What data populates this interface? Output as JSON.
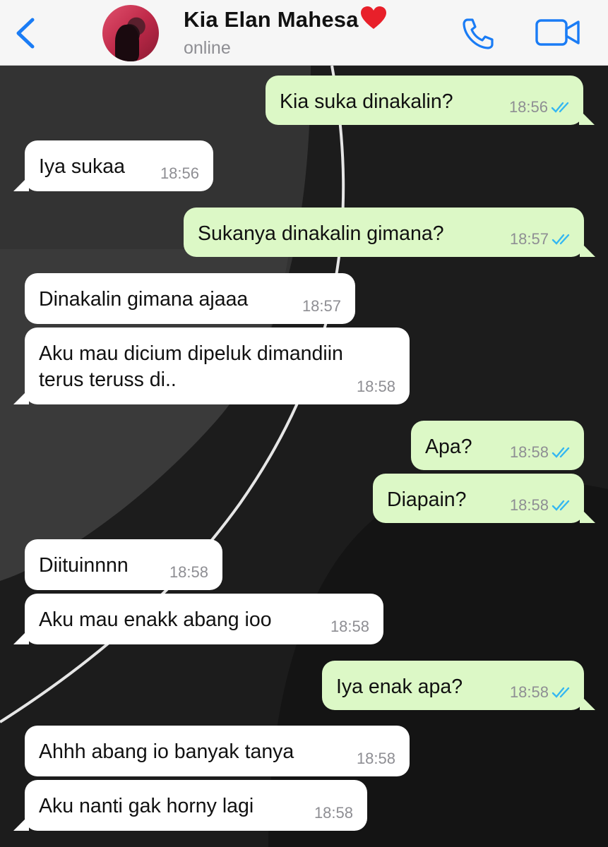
{
  "header": {
    "contact_name": "Kia Elan Mahesa",
    "status": "online",
    "accent_color": "#1a7cf5"
  },
  "messages": [
    {
      "dir": "out",
      "text": "Kia suka dinakalin?",
      "time": "18:56"
    },
    {
      "dir": "in",
      "text": "Iya sukaa",
      "time": "18:56"
    },
    {
      "dir": "out",
      "text": "Sukanya dinakalin gimana?",
      "time": "18:57"
    },
    {
      "dir": "in",
      "text": "Dinakalin gimana ajaaa",
      "time": "18:57"
    },
    {
      "dir": "in",
      "text_line1": "Aku mau dicium dipeluk dimandiin",
      "text_line2": "terus teruss di..",
      "time": "18:58"
    },
    {
      "dir": "out",
      "text": "Apa?",
      "time": "18:58"
    },
    {
      "dir": "out",
      "text": "Diapain?",
      "time": "18:58"
    },
    {
      "dir": "in",
      "text": "Diituinnnn",
      "time": "18:58"
    },
    {
      "dir": "in",
      "text": "Aku mau enakk abang ioo",
      "time": "18:58"
    },
    {
      "dir": "out",
      "text": "Iya enak apa?",
      "time": "18:58"
    },
    {
      "dir": "in",
      "text": "Ahhh abang io banyak tanya",
      "time": "18:58"
    },
    {
      "dir": "in",
      "text": "Aku nanti gak horny lagi",
      "time": "18:58"
    }
  ],
  "colors": {
    "incoming_bubble": "#ffffff",
    "outgoing_bubble": "#dcf8c6",
    "read_ticks": "#34b7f1"
  }
}
